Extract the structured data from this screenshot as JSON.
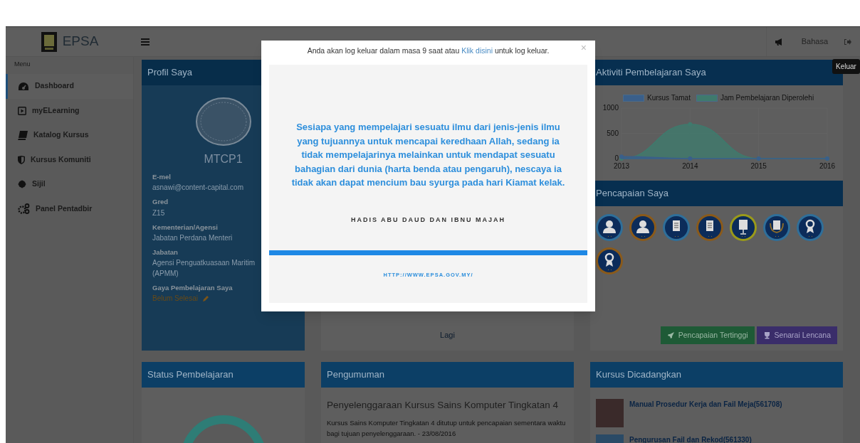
{
  "header": {
    "logo_text": "EPSA",
    "language": "Bahasa",
    "tooltip": "Keluar"
  },
  "sidebar": {
    "heading": "Menu",
    "items": [
      {
        "label": "Dashboard",
        "selected": true
      },
      {
        "label": "myELearning",
        "selected": false
      },
      {
        "label": "Katalog Kursus",
        "selected": false
      },
      {
        "label": "Kursus Komuniti",
        "selected": false
      },
      {
        "label": "Sijil",
        "selected": false
      },
      {
        "label": "Panel Pentadbir",
        "selected": false
      }
    ]
  },
  "profile": {
    "title": "Profil Saya",
    "name": "MTCP1",
    "fields": [
      {
        "kind": "text",
        "label": "E-mel",
        "value": "asnawi@content-capital.com"
      },
      {
        "kind": "text",
        "label": "Gred",
        "value": "Z15"
      },
      {
        "kind": "text",
        "label": "Kementerian/Agensi",
        "value": "Jabatan Perdana Menteri"
      },
      {
        "kind": "text",
        "label": "Jabatan",
        "value": "Agensi Penguatkuasaan Maritim (APMM)"
      },
      {
        "kind": "status",
        "label": "Gaya Pembelajaran Saya",
        "value": "Belum Selesai"
      }
    ]
  },
  "middle_panel": {
    "more_link": "Lagi"
  },
  "activity": {
    "title": "Aktiviti Pembelajaran Saya",
    "chart_data": {
      "type": "area",
      "legend": true,
      "x": [
        2013,
        2014,
        2015,
        2016
      ],
      "xticks": [
        2013,
        2014,
        2015,
        2016
      ],
      "xlim": [
        2013,
        2016
      ],
      "yticks": [
        0,
        500,
        1000
      ],
      "ylim": [
        0,
        1000
      ],
      "series": [
        {
          "name": "Kursus Tamat",
          "color": "#3a5f8a",
          "values": [
            40,
            0,
            0,
            0
          ]
        },
        {
          "name": "Jam Pembelajaran Diperolehi",
          "color": "#3f7a6d",
          "values": [
            0,
            680,
            0,
            0
          ]
        }
      ]
    }
  },
  "achievements": {
    "title": "Pencapaian Saya",
    "badges": [
      {
        "kind": "person",
        "color": "#2f6f9a"
      },
      {
        "kind": "person",
        "color": "#8a5a1a"
      },
      {
        "kind": "document",
        "color": "#2f6f9a"
      },
      {
        "kind": "document",
        "color": "#8a5a1a"
      },
      {
        "kind": "stand",
        "color": "#9a9a1a"
      },
      {
        "kind": "laurel",
        "color": "#2f6f9a"
      },
      {
        "kind": "ribbon",
        "color": "#2f6f9a"
      },
      {
        "kind": "ribbon",
        "color": "#8a5a1a"
      }
    ],
    "buttons": [
      {
        "kind": "top",
        "label": "Pencapaian Tertinggi"
      },
      {
        "kind": "list",
        "label": "Senarai Lencana"
      }
    ]
  },
  "status_panel": {
    "title": "Status Pembelajaran"
  },
  "announcements": {
    "title": "Pengumuman",
    "items": [
      {
        "title": "Penyelenggaraan Kursus Sains Komputer Tingkatan 4",
        "body": "Kursus Sains Komputer Tingkatan 4 ditutup untuk pencapaian sementara waktu bagi tujuan penyelenggaraan.",
        "date": "- 23/08/2016"
      }
    ]
  },
  "recommended": {
    "title": "Kursus Dicadangkan",
    "items": [
      {
        "title": "Manual Prosedur Kerja dan Fail Meja(561708)"
      },
      {
        "title": "Pengurusan Fail dan Rekod(561330)"
      }
    ]
  },
  "modal": {
    "notice_before": "Anda akan log keluar dalam masa 9 saat atau ",
    "notice_link": "Klik disini",
    "notice_after": " untuk log keluar.",
    "close": "×",
    "quote": "Sesiapa yang mempelajari sesuatu ilmu dari jenis-jenis ilmu yang tujuannya untuk mencapai keredhaan Allah, sedang ia tidak mempelajarinya melainkan untuk mendapat sesuatu bahagian dari dunia (harta benda atau pengaruh), nescaya ia tidak akan dapat mencium bau syurga pada hari Kiamat kelak.",
    "source": "HADIS ABU DAUD DAN IBNU MAJAH",
    "progress": {
      "level": 1
    },
    "url": "HTTP://WWW.EPSA.GOV.MY/"
  }
}
